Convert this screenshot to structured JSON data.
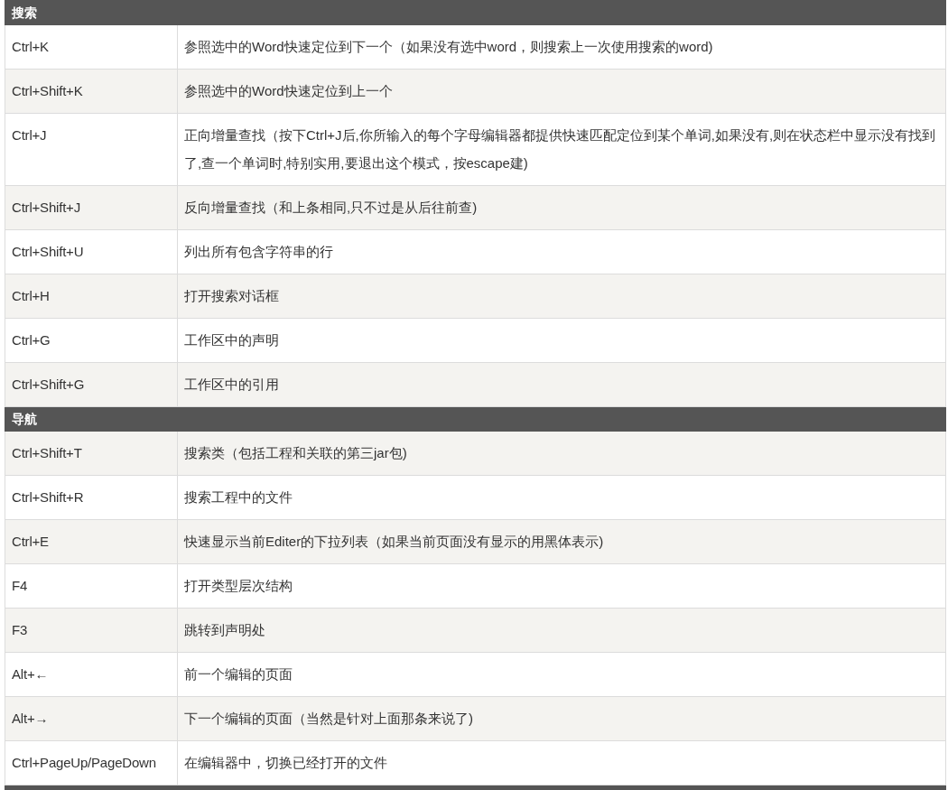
{
  "sections": [
    {
      "title": "搜索",
      "rows": [
        {
          "keys": "Ctrl+K",
          "description": "参照选中的Word快速定位到下一个（如果没有选中word，则搜索上一次使用搜索的word)"
        },
        {
          "keys": "Ctrl+Shift+K",
          "description": "参照选中的Word快速定位到上一个"
        },
        {
          "keys": "Ctrl+J",
          "description": "正向增量查找（按下Ctrl+J后,你所输入的每个字母编辑器都提供快速匹配定位到某个单词,如果没有,则在状态栏中显示没有找到了,查一个单词时,特别实用,要退出这个模式，按escape建)"
        },
        {
          "keys": "Ctrl+Shift+J",
          "description": "反向增量查找（和上条相同,只不过是从后往前查)"
        },
        {
          "keys": "Ctrl+Shift+U",
          "description": "列出所有包含字符串的行"
        },
        {
          "keys": "Ctrl+H",
          "description": "打开搜索对话框"
        },
        {
          "keys": "Ctrl+G",
          "description": "工作区中的声明"
        },
        {
          "keys": "Ctrl+Shift+G",
          "description": "工作区中的引用"
        }
      ]
    },
    {
      "title": "导航",
      "rows": [
        {
          "keys": "Ctrl+Shift+T",
          "description": "搜索类（包括工程和关联的第三jar包)"
        },
        {
          "keys": "Ctrl+Shift+R",
          "description": "搜索工程中的文件"
        },
        {
          "keys": "Ctrl+E",
          "description": "快速显示当前Editer的下拉列表（如果当前页面没有显示的用黑体表示)"
        },
        {
          "keys": "F4",
          "description": "打开类型层次结构"
        },
        {
          "keys": "F3",
          "description": "跳转到声明处"
        },
        {
          "keys": "Alt+←",
          "description": "前一个编辑的页面"
        },
        {
          "keys": "Alt+→",
          "description": "下一个编辑的页面（当然是针对上面那条来说了)"
        },
        {
          "keys": "Ctrl+PageUp/PageDown",
          "description": "在编辑器中，切换已经打开的文件"
        }
      ]
    }
  ]
}
